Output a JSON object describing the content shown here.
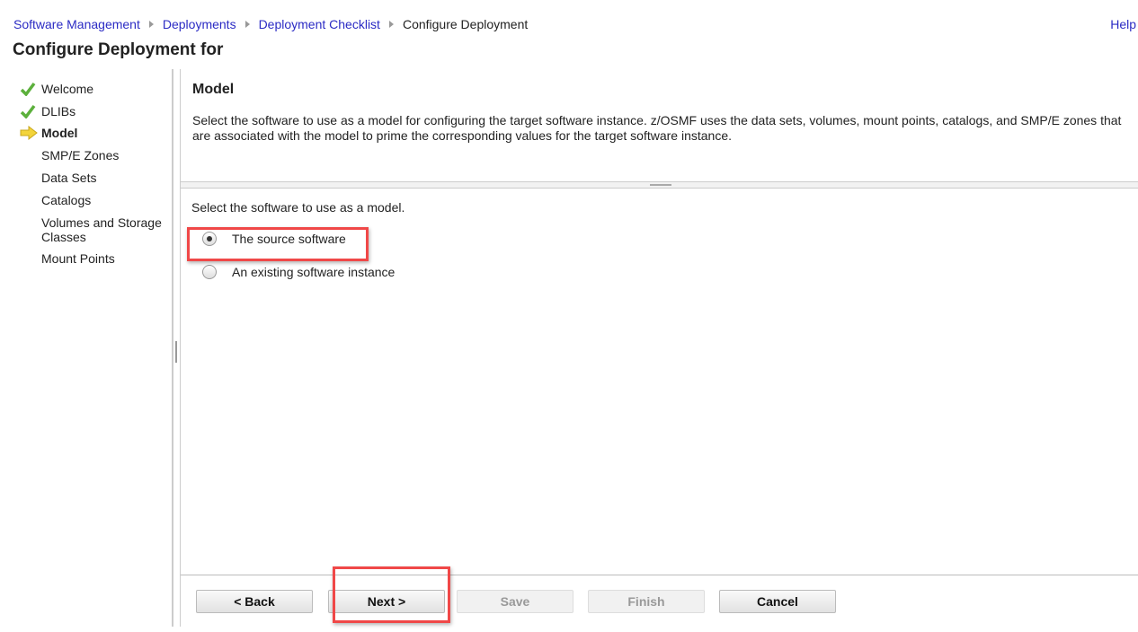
{
  "breadcrumb": [
    "Software Management",
    "Deployments",
    "Deployment Checklist",
    "Configure Deployment"
  ],
  "help": "Help",
  "title": "Configure Deployment for",
  "nav": [
    {
      "label": "Welcome",
      "state": "done"
    },
    {
      "label": "DLIBs",
      "state": "done"
    },
    {
      "label": "Model",
      "state": "current"
    },
    {
      "label": "SMP/E Zones"
    },
    {
      "label": "Data Sets"
    },
    {
      "label": "Catalogs"
    },
    {
      "label": "Volumes and Storage Classes"
    },
    {
      "label": "Mount Points"
    }
  ],
  "main": {
    "heading": "Model",
    "description": "Select the software to use as a model for configuring the target software instance.  z/OSMF uses the data sets, volumes, mount points, catalogs, and SMP/E zones that are associated with the model to prime the corresponding values for the target software instance.",
    "prompt": "Select the software to use as a model.",
    "options": [
      {
        "label": "The source software",
        "selected": true
      },
      {
        "label": "An existing software instance",
        "selected": false
      }
    ]
  },
  "buttons": {
    "back": "< Back",
    "next": "Next >",
    "save": "Save",
    "finish": "Finish",
    "cancel": "Cancel"
  }
}
